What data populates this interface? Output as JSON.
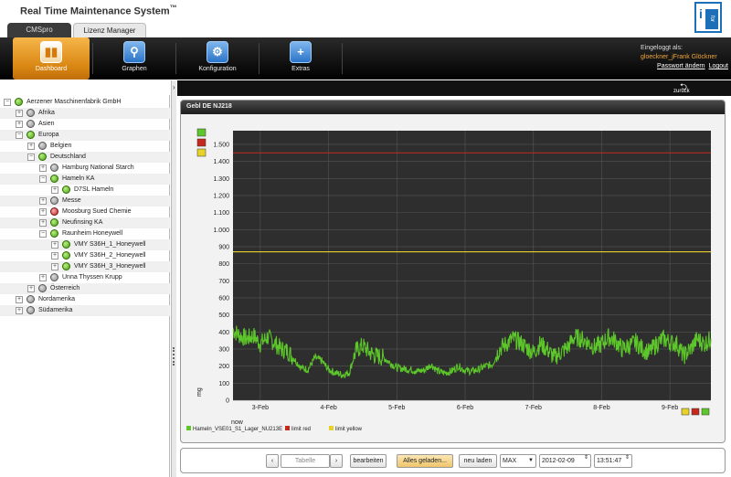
{
  "app": {
    "title": "Real Time Maintenance System",
    "title_mark": "™",
    "logo_letter": "i",
    "logo_text": "for",
    "tabs": [
      {
        "label": "CMSpro"
      },
      {
        "label": "Lizenz Manager"
      }
    ]
  },
  "nav": {
    "items": [
      {
        "label": "Dashboard",
        "icon": "bar-chart-icon",
        "glyph": "▮▮"
      },
      {
        "label": "Graphen",
        "icon": "magnifier-icon",
        "glyph": "⚲"
      },
      {
        "label": "Konfiguration",
        "icon": "gear-icon",
        "glyph": "⚙"
      },
      {
        "label": "Extras",
        "icon": "plus-icon",
        "glyph": "+"
      }
    ],
    "active": "Dashboard"
  },
  "user": {
    "logged_in_label": "Eingeloggt als:",
    "name": "gloeckner_jFrank Glöckner",
    "change_password": "Passwort ändern",
    "logout": "Logout"
  },
  "toolbar": {
    "back_label": "zurück",
    "back_icon": "back-arrow-icon",
    "splitter_arrow": "›"
  },
  "tree": [
    {
      "label": "Aerzener Maschinenfabrik GmbH",
      "level": 0,
      "toggle": "−",
      "status": "green"
    },
    {
      "label": "Afrika",
      "level": 1,
      "toggle": "+",
      "status": "grey"
    },
    {
      "label": "Asien",
      "level": 1,
      "toggle": "+",
      "status": "grey"
    },
    {
      "label": "Europa",
      "level": 1,
      "toggle": "−",
      "status": "green"
    },
    {
      "label": "Belgien",
      "level": 2,
      "toggle": "+",
      "status": "grey"
    },
    {
      "label": "Deutschland",
      "level": 2,
      "toggle": "−",
      "status": "green"
    },
    {
      "label": "Hamburg National Starch",
      "level": 3,
      "toggle": "+",
      "status": "grey"
    },
    {
      "label": "Hameln KA",
      "level": 3,
      "toggle": "−",
      "status": "green"
    },
    {
      "label": "D7SL Hameln",
      "level": 4,
      "toggle": "+",
      "status": "green"
    },
    {
      "label": "Messe",
      "level": 3,
      "toggle": "+",
      "status": "grey"
    },
    {
      "label": "Moosburg Sued Chemie",
      "level": 3,
      "toggle": "+",
      "status": "red"
    },
    {
      "label": "Neufinsing KA",
      "level": 3,
      "toggle": "+",
      "status": "green"
    },
    {
      "label": "Raunheim Honeywell",
      "level": 3,
      "toggle": "−",
      "status": "green"
    },
    {
      "label": "VMY S36H_1_Honeywell",
      "level": 4,
      "toggle": "+",
      "status": "green"
    },
    {
      "label": "VMY S36H_2_Honeywell",
      "level": 4,
      "toggle": "+",
      "status": "green"
    },
    {
      "label": "VMY S36H_3_Honeywell",
      "level": 4,
      "toggle": "+",
      "status": "green"
    },
    {
      "label": "Unna Thyssen Krupp",
      "level": 3,
      "toggle": "+",
      "status": "grey"
    },
    {
      "label": "Österreich",
      "level": 2,
      "toggle": "+",
      "status": "grey"
    },
    {
      "label": "Nordamerika",
      "level": 1,
      "toggle": "+",
      "status": "grey"
    },
    {
      "label": "Südamerika",
      "level": 1,
      "toggle": "+",
      "status": "grey"
    }
  ],
  "panel": {
    "title": "Gebl DE NJ218"
  },
  "colors": {
    "series": "#5cc62a",
    "limit_red": "#c6281e",
    "limit_yellow": "#e8d22a",
    "plot_bg": "#2e2e2e",
    "grid": "#555555"
  },
  "chart_data": {
    "type": "line",
    "title": "",
    "xlabel": "",
    "ylabel": "mg",
    "x_ticks": [
      "3-Feb",
      "4-Feb",
      "5-Feb",
      "6-Feb",
      "7-Feb",
      "8-Feb",
      "9-Feb"
    ],
    "x_start_label": "now",
    "y_ticks": [
      "0",
      "100",
      "200",
      "300",
      "400",
      "500",
      "600",
      "700",
      "800",
      "900",
      "1.000",
      "1.100",
      "1.200",
      "1.300",
      "1.400",
      "1.500"
    ],
    "ylim": [
      0,
      1580
    ],
    "x_range_days": [
      2.6,
      9.6
    ],
    "legend_position": "bottom-left",
    "series": [
      {
        "name": "Hameln_VSE01_S1_Lager_NU213E",
        "points": [
          [
            2.6,
            410
          ],
          [
            2.7,
            380
          ],
          [
            2.8,
            360
          ],
          [
            2.9,
            380
          ],
          [
            3.0,
            330
          ],
          [
            3.1,
            370
          ],
          [
            3.2,
            340
          ],
          [
            3.3,
            300
          ],
          [
            3.4,
            290
          ],
          [
            3.5,
            240
          ],
          [
            3.6,
            190
          ],
          [
            3.7,
            180
          ],
          [
            3.8,
            250
          ],
          [
            3.9,
            230
          ],
          [
            4.0,
            180
          ],
          [
            4.1,
            160
          ],
          [
            4.2,
            150
          ],
          [
            4.3,
            160
          ],
          [
            4.4,
            290
          ],
          [
            4.5,
            320
          ],
          [
            4.6,
            280
          ],
          [
            4.7,
            260
          ],
          [
            4.8,
            250
          ],
          [
            4.9,
            220
          ],
          [
            5.0,
            190
          ],
          [
            5.1,
            185
          ],
          [
            5.2,
            180
          ],
          [
            5.3,
            170
          ],
          [
            5.4,
            175
          ],
          [
            5.5,
            210
          ],
          [
            5.6,
            170
          ],
          [
            5.7,
            160
          ],
          [
            5.8,
            170
          ],
          [
            5.9,
            200
          ],
          [
            6.0,
            175
          ],
          [
            6.1,
            170
          ],
          [
            6.2,
            180
          ],
          [
            6.3,
            200
          ],
          [
            6.4,
            210
          ],
          [
            6.5,
            300
          ],
          [
            6.6,
            330
          ],
          [
            6.7,
            360
          ],
          [
            6.8,
            340
          ],
          [
            6.9,
            310
          ],
          [
            7.0,
            280
          ],
          [
            7.1,
            330
          ],
          [
            7.2,
            300
          ],
          [
            7.3,
            250
          ],
          [
            7.4,
            280
          ],
          [
            7.5,
            310
          ],
          [
            7.6,
            370
          ],
          [
            7.7,
            360
          ],
          [
            7.8,
            340
          ],
          [
            7.9,
            310
          ],
          [
            8.0,
            330
          ],
          [
            8.1,
            370
          ],
          [
            8.2,
            350
          ],
          [
            8.3,
            300
          ],
          [
            8.4,
            320
          ],
          [
            8.5,
            340
          ],
          [
            8.6,
            300
          ],
          [
            8.7,
            280
          ],
          [
            8.8,
            330
          ],
          [
            8.9,
            360
          ],
          [
            9.0,
            340
          ],
          [
            9.1,
            330
          ],
          [
            9.2,
            260
          ],
          [
            9.3,
            300
          ],
          [
            9.4,
            360
          ],
          [
            9.5,
            330
          ],
          [
            9.6,
            360
          ]
        ]
      },
      {
        "name": "limit red",
        "value": 1450
      },
      {
        "name": "limit yellow",
        "value": 870
      }
    ]
  },
  "controls": {
    "prev": "‹",
    "table": "Tabelle",
    "next": "›",
    "edit": "bearbeiten",
    "all_loaded": "Alles geladen...",
    "reload": "neu laden",
    "range": "MAX",
    "range_caret": "▼",
    "date": "2012-02-09",
    "time": "13:51:47",
    "spin": "⇕"
  }
}
